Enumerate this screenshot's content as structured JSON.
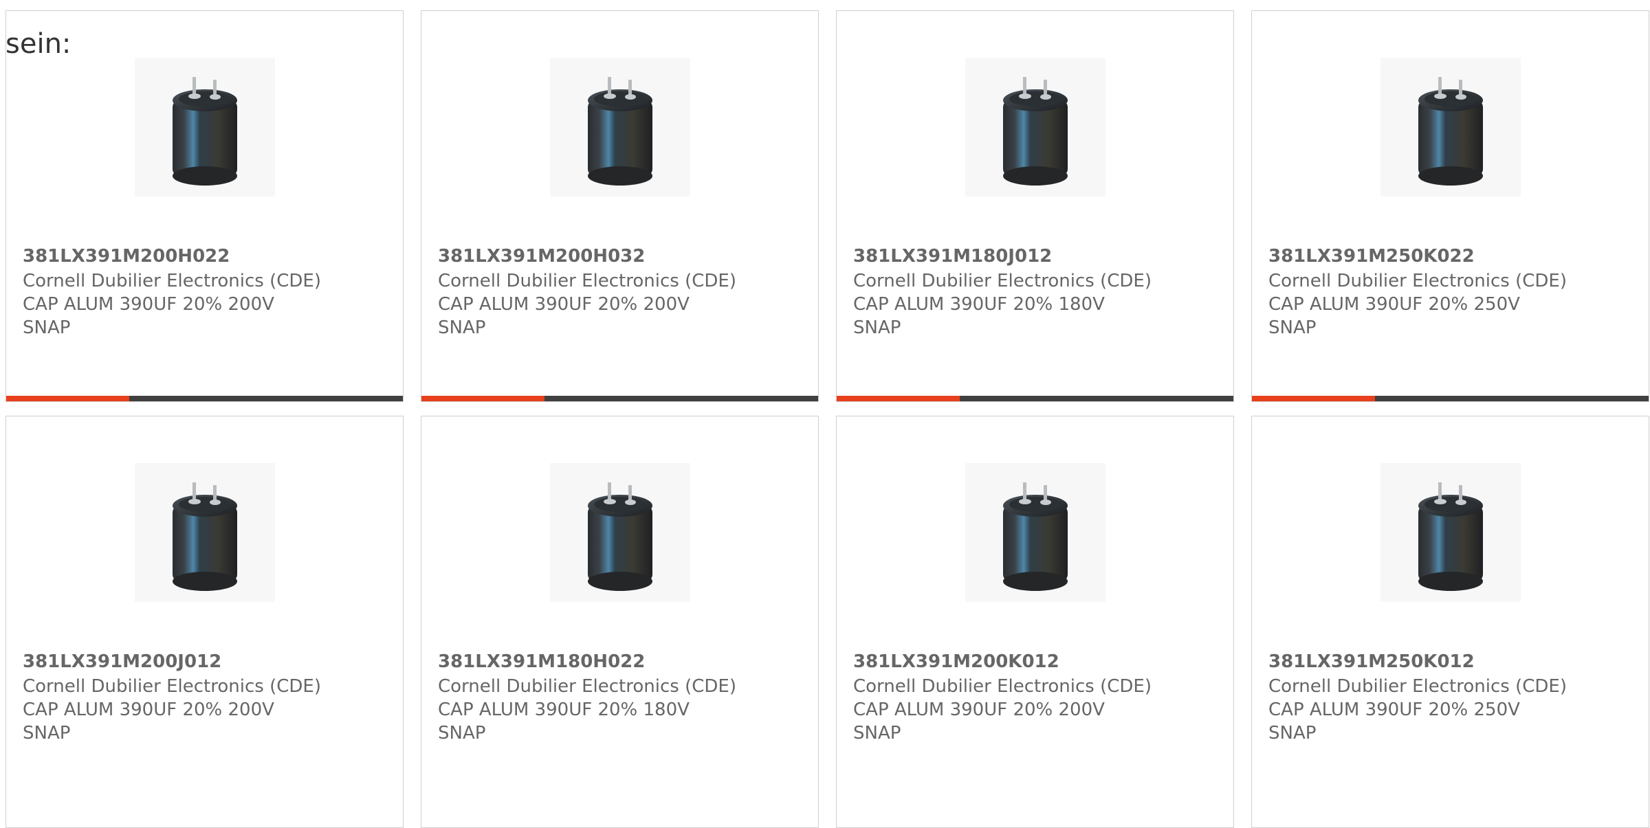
{
  "intro_text": "sein:",
  "colors": {
    "accent": "#e8401c",
    "bar_track": "#404040",
    "text": "#666666",
    "border": "#cfcfcf"
  },
  "products": [
    {
      "part_number": "381LX391M200H022",
      "manufacturer": "Cornell Dubilier Electronics (CDE)",
      "description_line1": "CAP ALUM 390UF 20% 200V",
      "description_line2": "SNAP",
      "icon": "capacitor-icon",
      "progress": 0.31
    },
    {
      "part_number": "381LX391M200H032",
      "manufacturer": "Cornell Dubilier Electronics (CDE)",
      "description_line1": "CAP ALUM 390UF 20% 200V",
      "description_line2": "SNAP",
      "icon": "capacitor-icon",
      "progress": 0.31
    },
    {
      "part_number": "381LX391M180J012",
      "manufacturer": "Cornell Dubilier Electronics (CDE)",
      "description_line1": "CAP ALUM 390UF 20% 180V",
      "description_line2": "SNAP",
      "icon": "capacitor-icon",
      "progress": 0.31
    },
    {
      "part_number": "381LX391M250K022",
      "manufacturer": "Cornell Dubilier Electronics (CDE)",
      "description_line1": "CAP ALUM 390UF 20% 250V",
      "description_line2": "SNAP",
      "icon": "capacitor-icon",
      "progress": 0.31
    },
    {
      "part_number": "381LX391M200J012",
      "manufacturer": "Cornell Dubilier Electronics (CDE)",
      "description_line1": "CAP ALUM 390UF 20% 200V",
      "description_line2": "SNAP",
      "icon": "capacitor-icon"
    },
    {
      "part_number": "381LX391M180H022",
      "manufacturer": "Cornell Dubilier Electronics (CDE)",
      "description_line1": "CAP ALUM 390UF 20% 180V",
      "description_line2": "SNAP",
      "icon": "capacitor-icon"
    },
    {
      "part_number": "381LX391M200K012",
      "manufacturer": "Cornell Dubilier Electronics (CDE)",
      "description_line1": "CAP ALUM 390UF 20% 200V",
      "description_line2": "SNAP",
      "icon": "capacitor-icon"
    },
    {
      "part_number": "381LX391M250K012",
      "manufacturer": "Cornell Dubilier Electronics (CDE)",
      "description_line1": "CAP ALUM 390UF 20% 250V",
      "description_line2": "SNAP",
      "icon": "capacitor-icon"
    }
  ]
}
